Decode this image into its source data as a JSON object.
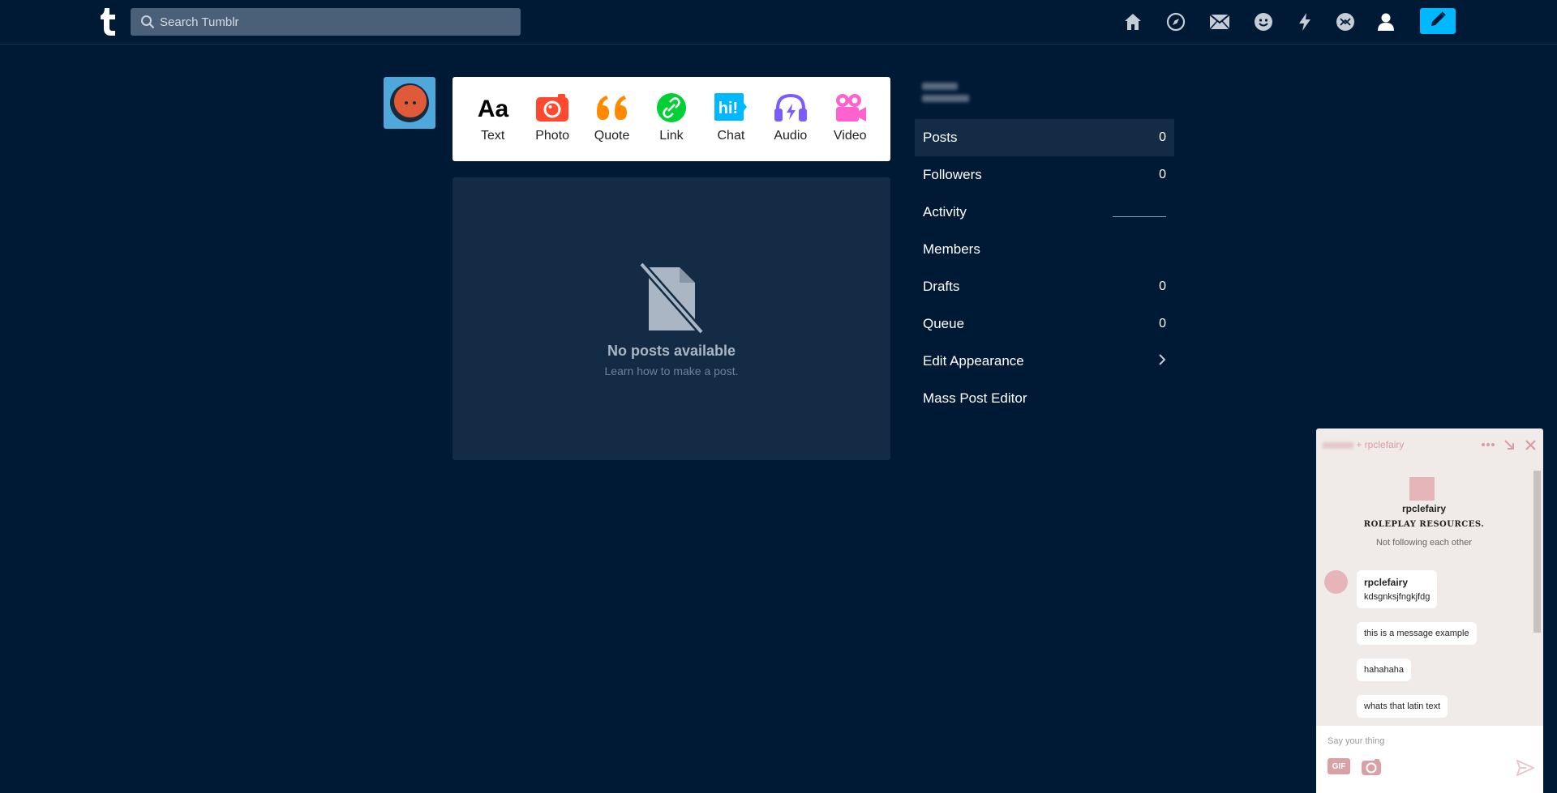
{
  "header": {
    "search_placeholder": "Search Tumblr",
    "nav_icons": [
      "home-icon",
      "explore-icon",
      "inbox-icon",
      "messages-icon",
      "activity-icon",
      "labs-icon",
      "account-icon"
    ],
    "compose_icon": "pencil-icon"
  },
  "post_types": [
    {
      "label": "Text",
      "icon": "text-icon",
      "color": "#000000"
    },
    {
      "label": "Photo",
      "icon": "camera-icon",
      "color": "#ff492f"
    },
    {
      "label": "Quote",
      "icon": "quote-icon",
      "color": "#ff8a00"
    },
    {
      "label": "Link",
      "icon": "link-icon",
      "color": "#00cf35"
    },
    {
      "label": "Chat",
      "icon": "chat-icon",
      "color": "#00b8ff"
    },
    {
      "label": "Audio",
      "icon": "headphones-icon",
      "color": "#7c5cff"
    },
    {
      "label": "Video",
      "icon": "video-camera-icon",
      "color": "#ff62ce"
    }
  ],
  "empty_state": {
    "title": "No posts available",
    "subtitle": "Learn how to make a post."
  },
  "sidebar": {
    "items": [
      {
        "label": "Posts",
        "count": "0"
      },
      {
        "label": "Followers",
        "count": "0"
      },
      {
        "label": "Activity",
        "count": ""
      },
      {
        "label": "Members",
        "count": ""
      },
      {
        "label": "Drafts",
        "count": "0"
      },
      {
        "label": "Queue",
        "count": "0"
      },
      {
        "label": "Edit Appearance",
        "count": ""
      },
      {
        "label": "Mass Post Editor",
        "count": ""
      }
    ]
  },
  "chat": {
    "title_suffix": "+ rpclefairy",
    "profile_name": "rpclefairy",
    "profile_title": "ROLEPLAY RESOURCES.",
    "follow_status": "Not following each other",
    "messages": [
      {
        "sender": "rpclefairy",
        "text": "kdsgnksjfngkjfdg"
      },
      {
        "sender": "",
        "text": "this is a message example"
      },
      {
        "sender": "",
        "text": "hahahaha"
      },
      {
        "sender": "",
        "text": "whats that latin text"
      }
    ],
    "input_placeholder": "Say your thing",
    "gif_label": "GIF"
  },
  "colors": {
    "background": "#001935",
    "panel": "#132b45",
    "accent": "#00b8ff",
    "chat_pink": "#d99ca2"
  }
}
